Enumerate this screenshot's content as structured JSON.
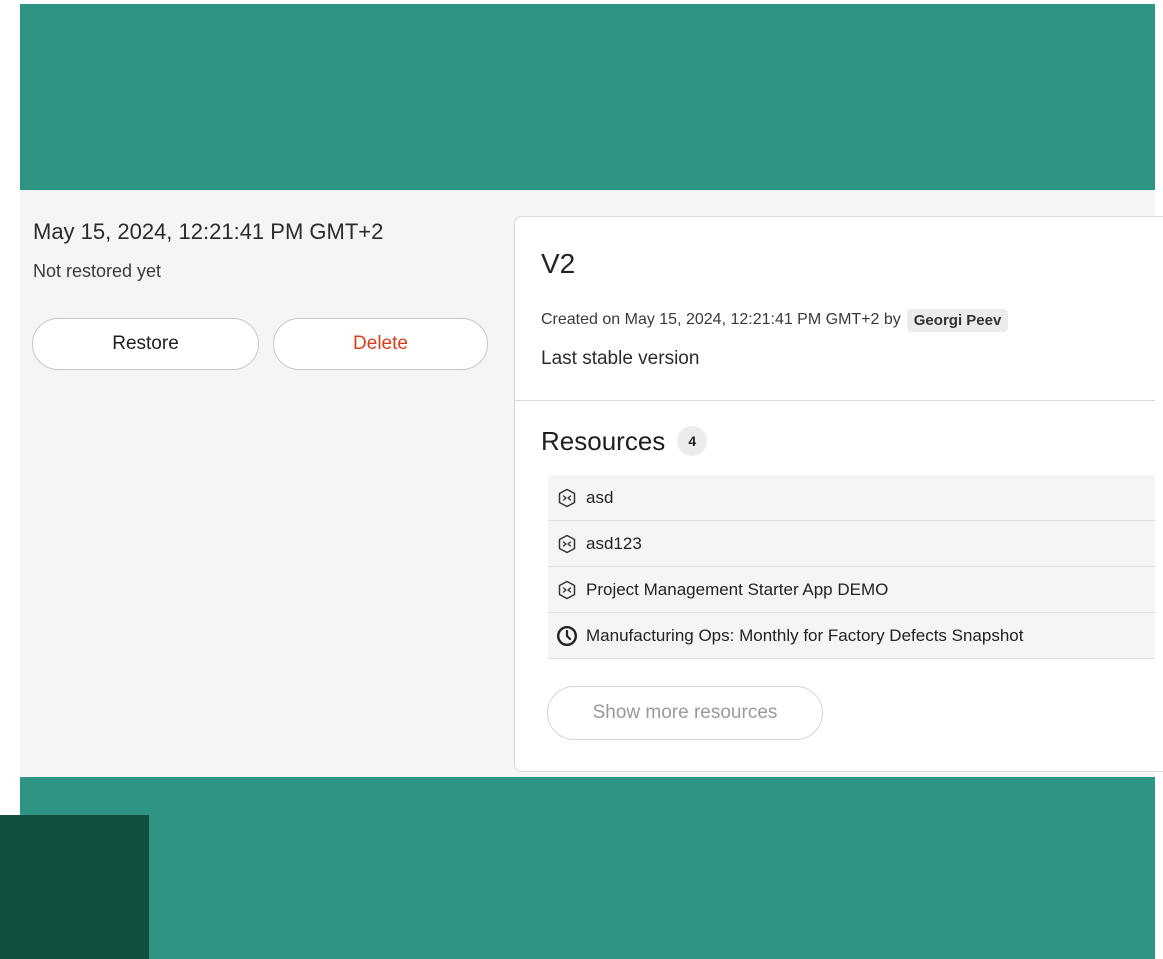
{
  "history_entry": {
    "timestamp": "May 15, 2024, 12:21:41 PM GMT+2",
    "restore_status": "Not restored yet",
    "restore_label": "Restore",
    "delete_label": "Delete"
  },
  "version": {
    "title": "V2",
    "created_prefix": "Created on May 15, 2024, 12:21:41 PM GMT+2 by",
    "author": "Georgi Peev",
    "description": "Last stable version"
  },
  "resources": {
    "title": "Resources",
    "count": "4",
    "items": [
      {
        "label": "asd",
        "icon": "app-hexagon-icon"
      },
      {
        "label": "asd123",
        "icon": "app-hexagon-icon"
      },
      {
        "label": "Project Management Starter App DEMO",
        "icon": "app-hexagon-icon"
      },
      {
        "label": "Manufacturing Ops: Monthly for Factory Defects Snapshot",
        "icon": "clock-icon"
      }
    ],
    "show_more_label": "Show more resources"
  },
  "colors": {
    "band": "#2e9484",
    "dark_block": "#124f3e",
    "delete_text": "#d4401c",
    "panel_bg": "#f5f5f7"
  }
}
